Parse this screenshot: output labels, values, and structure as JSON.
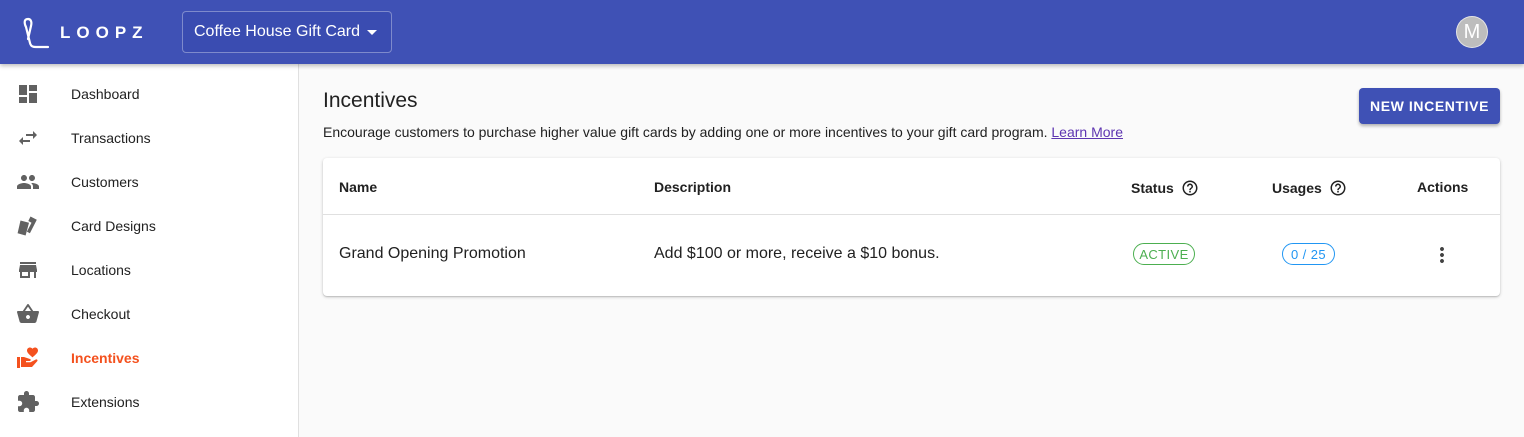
{
  "app": {
    "logo_text": "LOOPZ",
    "program_selector": "Coffee House Gift Card",
    "avatar_initial": "M",
    "brand_color": "#3f51b5",
    "active_color": "#f4511e"
  },
  "sidebar": {
    "items": [
      {
        "label": "Dashboard",
        "icon": "dashboard-icon"
      },
      {
        "label": "Transactions",
        "icon": "swap-arrows-icon"
      },
      {
        "label": "Customers",
        "icon": "people-icon"
      },
      {
        "label": "Card Designs",
        "icon": "cards-icon"
      },
      {
        "label": "Locations",
        "icon": "store-icon"
      },
      {
        "label": "Checkout",
        "icon": "basket-icon"
      },
      {
        "label": "Incentives",
        "icon": "heart-hand-icon",
        "active": true
      },
      {
        "label": "Extensions",
        "icon": "puzzle-icon"
      }
    ]
  },
  "main": {
    "title": "Incentives",
    "description": "Encourage customers to purchase higher value gift cards by adding one or more incentives to your gift card program.",
    "learn_more": "Learn More",
    "new_button": "NEW INCENTIVE",
    "table": {
      "headers": {
        "name": "Name",
        "description": "Description",
        "status": "Status",
        "usages": "Usages",
        "actions": "Actions"
      },
      "rows": [
        {
          "name": "Grand Opening Promotion",
          "description": "Add $100 or more, receive a $10 bonus.",
          "status": "ACTIVE",
          "usages": "0 / 25"
        }
      ]
    }
  }
}
